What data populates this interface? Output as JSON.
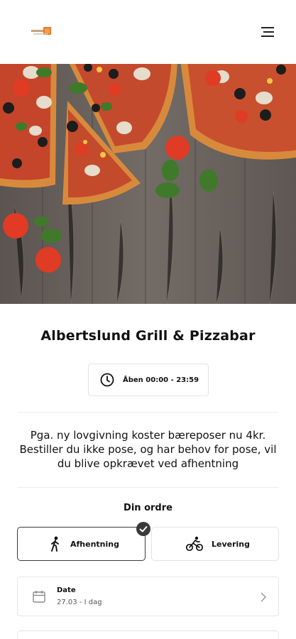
{
  "header": {
    "logo_icon": "restaurant-logo",
    "menu_icon": "hamburger-menu-icon"
  },
  "hero": {
    "image": "pizza-on-wooden-table"
  },
  "restaurant": {
    "name": "Albertslund Grill & Pizzabar",
    "hours": "Åben 00:00 - 23:59",
    "hours_icon": "clock-icon"
  },
  "notice": "Pga. ny lovgivning koster bæreposer nu 4kr. Bestiller du ikke pose, og har behov for pose, vil du blive opkrævet ved afhentning",
  "order": {
    "title": "Din ordre",
    "options": [
      {
        "label": "Afhentning",
        "icon": "walking-person-icon",
        "selected": true
      },
      {
        "label": "Levering",
        "icon": "cyclist-icon",
        "selected": false
      }
    ],
    "date": {
      "label": "Date",
      "value": "27.03 - I dag",
      "icon": "calendar-icon"
    }
  },
  "colors": {
    "accent": "#3a3a3a",
    "border": "#e4e4e4",
    "background": "#ffffff"
  }
}
